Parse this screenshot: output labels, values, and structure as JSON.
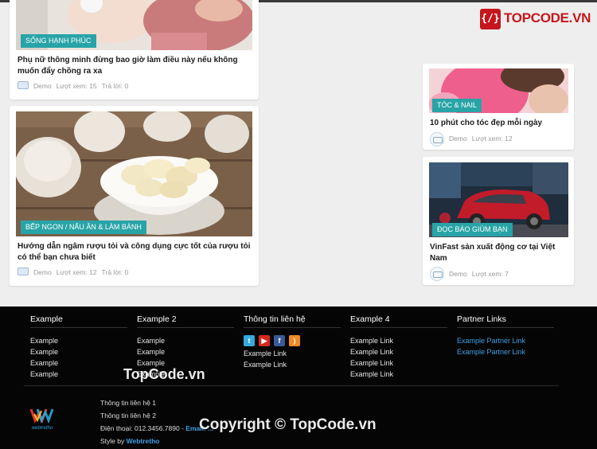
{
  "brand": {
    "name": "TOPCODE.VN",
    "badge": "{/}"
  },
  "posts": [
    {
      "tag": "Sống hạnh phúc",
      "title": "Phụ nữ thông minh đừng bao giờ làm điều này nếu không muốn đẩy chồng ra xa",
      "author": "Demo",
      "views": "Lượt xem: 15",
      "replies": "Trả lời: 0"
    },
    {
      "tag": "Bếp ngon / Nấu ăn & làm bánh",
      "title": "Hướng dẫn ngâm rượu tỏi và công dụng cực tốt của rượu tỏi có thể bạn chưa biết",
      "author": "Demo",
      "views": "Lượt xem: 12",
      "replies": "Trả lời: 0"
    },
    {
      "tag": "Tóc & Nail",
      "title": "10 phút cho tóc đẹp mỗi ngày",
      "author": "Demo",
      "views": "Lượt xem: 12"
    },
    {
      "tag": "Đọc báo giùm bạn",
      "title": "VinFast sản xuất động cơ tại Việt Nam",
      "author": "Demo",
      "views": "Lượt xem: 7"
    }
  ],
  "footer": {
    "columns": [
      {
        "title": "Example",
        "items": [
          "Example",
          "Example",
          "Example",
          "Example"
        ]
      },
      {
        "title": "Example 2",
        "items": [
          "Example",
          "Example",
          "Example",
          "Example"
        ]
      },
      {
        "title": "Thông tin liên hệ",
        "items": [
          "Example Link",
          "Example Link"
        ]
      },
      {
        "title": "Example 4",
        "items": [
          "Example Link",
          "Example Link",
          "Example Link",
          "Example Link"
        ]
      },
      {
        "title": "Partner Links",
        "items": [
          "Example Partner Link",
          "Example Partner Link"
        ]
      }
    ],
    "info": {
      "line1": "Thông tin liên hệ 1",
      "line2": "Thông tin liên hệ 2",
      "phone": "Điện thoại: 012.3456.7890 - ",
      "email": "Email: ...",
      "style_by": "Style by ",
      "style_link": "Webtretho"
    },
    "site_logo_text": "webtretho"
  },
  "watermarks": {
    "small": "TopCode.vn",
    "large": "Copyright © TopCode.vn"
  },
  "colors": {
    "tag_teal": "#28a4a7",
    "brand_red": "#c4161c",
    "footer_bg": "#050505",
    "link_blue": "#3ea0e6"
  },
  "icons": [
    "twitter-icon",
    "youtube-icon",
    "facebook-icon",
    "rss-icon"
  ]
}
